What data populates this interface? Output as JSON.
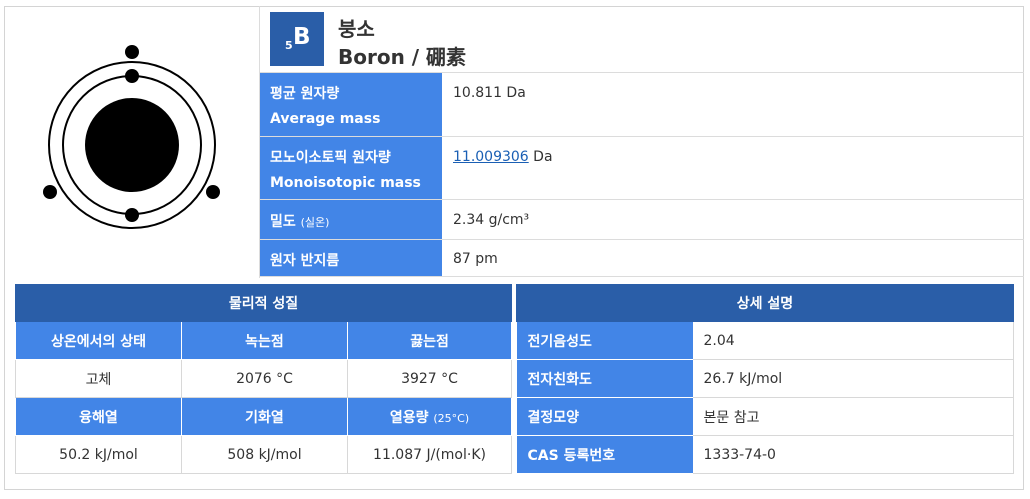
{
  "element": {
    "atomic_number": "5",
    "symbol": "B",
    "name_ko": "붕소",
    "name_en_cn": "Boron / 硼素"
  },
  "properties": [
    {
      "label": "평균 원자량",
      "label2": "Average mass",
      "value": "10.811 Da"
    },
    {
      "label": "모노이소토픽 원자량",
      "label2": "Monoisotopic mass",
      "value_link": "11.009306",
      "value_unit": " Da"
    },
    {
      "label": "밀도",
      "label_note": "(실온)",
      "value": "2.34 g/cm³"
    },
    {
      "label": "원자 반지름",
      "value": "87 pm"
    }
  ],
  "physical": {
    "title": "물리적 성질",
    "headers1": [
      "상온에서의 상태",
      "녹는점",
      "끓는점"
    ],
    "values1": [
      "고체",
      "2076 °C",
      "3927 °C"
    ],
    "headers2": [
      "융해열",
      "기화열",
      "열용량"
    ],
    "heat_capacity_note": "(25°C)",
    "values2": [
      "50.2 kJ/mol",
      "508 kJ/mol",
      "11.087 J/(mol·K)"
    ]
  },
  "details": {
    "title": "상세 설명",
    "rows": [
      {
        "label": "전기음성도",
        "value": "2.04"
      },
      {
        "label": "전자친화도",
        "value": "26.7 kJ/mol"
      },
      {
        "label": "결정모양",
        "value": "본문 참고"
      },
      {
        "label": "CAS 등록번호",
        "value": "1333-74-0"
      }
    ]
  },
  "colors": {
    "dark_blue": "#2a5ea8",
    "blue": "#4285e7"
  }
}
